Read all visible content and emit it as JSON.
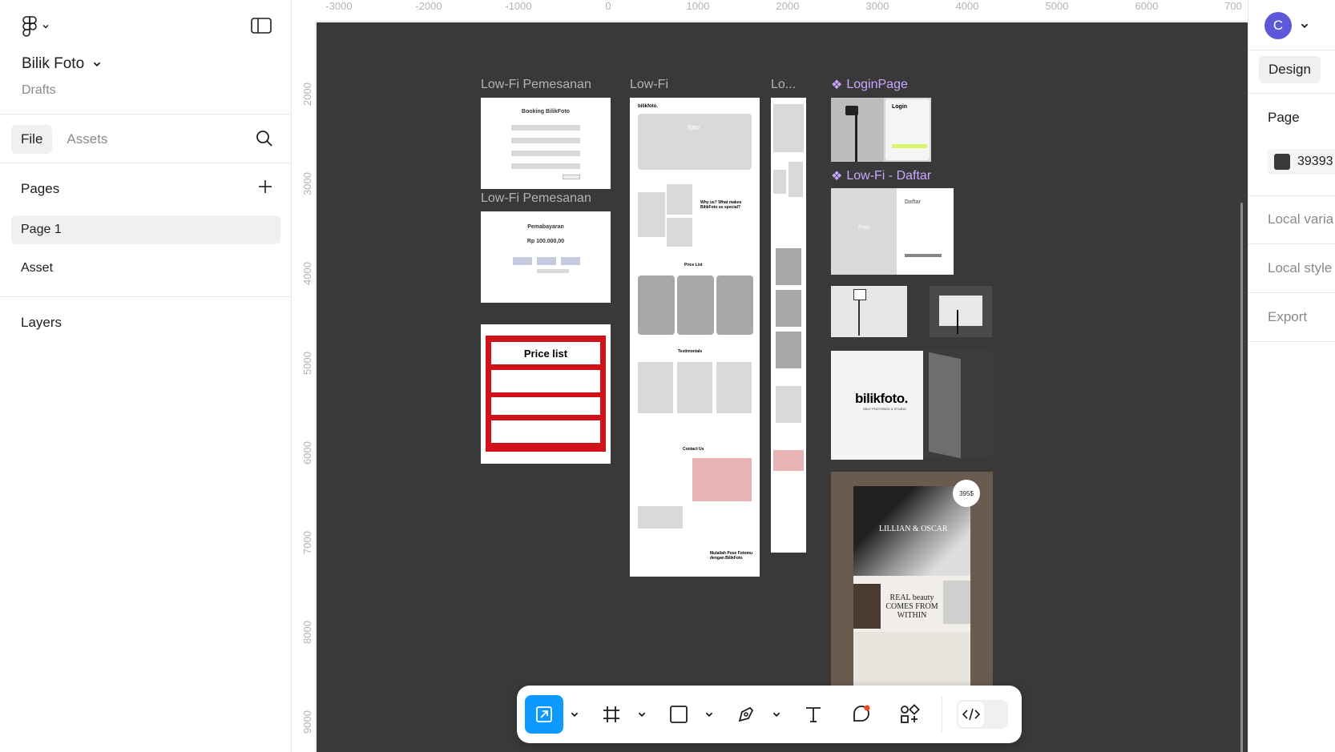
{
  "file": {
    "name": "Bilik Foto",
    "location": "Drafts"
  },
  "left_tabs": {
    "file": "File",
    "assets": "Assets"
  },
  "pages": {
    "heading": "Pages",
    "items": [
      "Page 1",
      "Asset"
    ]
  },
  "layers": {
    "heading": "Layers"
  },
  "ruler_top": [
    "-3000",
    "-2000",
    "-1000",
    "0",
    "1000",
    "2000",
    "3000",
    "4000",
    "5000",
    "6000",
    "700"
  ],
  "ruler_left": [
    "2000",
    "3000",
    "4000",
    "5000",
    "6000",
    "7000",
    "8000",
    "9000"
  ],
  "canvas": {
    "background": "#393939",
    "frames": {
      "booking_label": "Low-Fi Pemesanan",
      "booking_title": "Booking BilikFoto",
      "payment_label": "Low-Fi Pemesanan",
      "payment_title": "Pemabayaran",
      "payment_amount": "Rp 100.000,00",
      "pricelist_title": "Price list",
      "lowfi_label": "Low-Fi",
      "lowfi_brand": "bilikfoto.",
      "lowfi_hero": "foto",
      "lowfi_why": "Why us? What makes BilikFoto so special?",
      "lowfi_price": "Price List",
      "lowfi_testimonials": "Testimonials",
      "lowfi_contact": "Contact Us",
      "lowfi_footer": "Mulailah Pose Fotomu dengan BilikFoto",
      "lo_label": "Lo...",
      "login_label": "LoginPage",
      "login_title": "Login",
      "daftar_label": "Low-Fi - Daftar",
      "daftar_title": "Daftar",
      "daftar_foto": "Foto",
      "brand_big": "bilikfoto.",
      "brand_sub": "SELF PHOTOBOX & STUDIO",
      "wedding_badge": "395$",
      "wedding_names": "LILLIAN & OSCAR",
      "wedding_quote": "REAL beauty COMES FROM WITHIN"
    }
  },
  "right_panel": {
    "user_initial": "C",
    "design_tab": "Design",
    "page_heading": "Page",
    "page_color": "39393",
    "items": [
      "Local varia",
      "Local style",
      "Export"
    ],
    "accent": "#0d99ff"
  },
  "toolbar": {
    "icons": [
      "move-tool",
      "frame-tool",
      "shape-tool",
      "pen-tool",
      "text-tool",
      "comment-tool",
      "actions-tool",
      "dev-mode"
    ]
  }
}
